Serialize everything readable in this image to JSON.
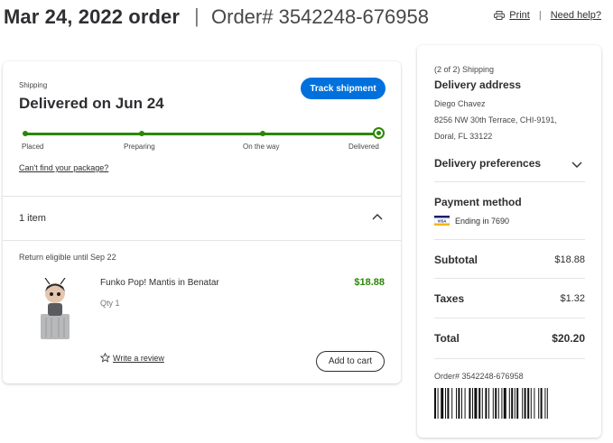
{
  "header": {
    "order_date_title": "Mar 24, 2022 order",
    "separator": "|",
    "order_number_title": "Order# 3542248-676958",
    "print_label": "Print",
    "help_label": "Need help?"
  },
  "shipment": {
    "section_label": "Shipping",
    "status": "Delivered on Jun 24",
    "track_button": "Track shipment",
    "progress": {
      "steps": [
        "Placed",
        "Preparing",
        "On the way",
        "Delivered"
      ],
      "current_step": "Delivered"
    },
    "cant_find_link": "Can't find your package?"
  },
  "items_section": {
    "count_label": "1 item",
    "return_eligible": "Return eligible until Sep 22",
    "items": [
      {
        "name": "Funko Pop! Mantis in Benatar",
        "qty": "Qty 1",
        "price": "$18.88",
        "write_review": "Write a review",
        "add_to_cart": "Add to cart"
      }
    ]
  },
  "summary": {
    "shipping_count": "(2 of 2) Shipping",
    "delivery_address_heading": "Delivery address",
    "address": {
      "name": "Diego Chavez",
      "line1": "8256 NW 30th Terrace, CHI-9191,",
      "line2": "Doral, FL 33122"
    },
    "delivery_preferences": "Delivery preferences",
    "payment_heading": "Payment method",
    "card_ending": "Ending in 7690",
    "subtotal_label": "Subtotal",
    "subtotal_value": "$18.88",
    "taxes_label": "Taxes",
    "taxes_value": "$1.32",
    "total_label": "Total",
    "total_value": "$20.20",
    "order_number": "Order# 3542248-676958"
  },
  "colors": {
    "accent_blue": "#0071dc",
    "success_green": "#2a8703",
    "text_primary": "#2e2f32",
    "text_secondary": "#46474a",
    "divider": "#e3e4e5"
  },
  "icons": [
    "printer-icon",
    "chevron-up-icon",
    "chevron-down-icon",
    "star-icon",
    "visa-card-icon",
    "barcode"
  ]
}
